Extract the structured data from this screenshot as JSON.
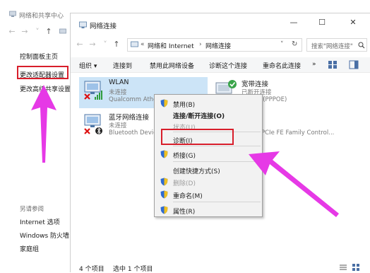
{
  "bg_window": {
    "title": "网络和共享中心",
    "sidebar": {
      "links": [
        "控制面板主页",
        "更改适配器设置",
        "更改高级共享设置"
      ],
      "see_also_label": "另请参阅",
      "see_also": [
        "Internet 选项",
        "Windows 防火墙",
        "家庭组"
      ]
    }
  },
  "main_window": {
    "title": "网络连接",
    "controls": {
      "minimize": "—",
      "maximize": "☐",
      "close": "✕"
    },
    "breadcrumb": {
      "prefix": "«",
      "parent": "网络和 Internet",
      "separator": "›",
      "current": "网络连接"
    },
    "search_placeholder": "搜索\"网络连接\"",
    "toolbar": [
      "组织 ▾",
      "连接到",
      "禁用此网络设备",
      "诊断这个连接",
      "重命名此连接",
      "»"
    ],
    "connections": [
      {
        "name": "WLAN",
        "status": "未连接",
        "device": "Qualcomm Athe"
      },
      {
        "name": "宽带连接",
        "status": "已断开连接",
        "device": "iniport (PPPOE)"
      },
      {
        "name": "蓝牙网络连接",
        "status": "未连接",
        "device": "Bluetooth Devic"
      },
      {
        "name": "",
        "status": "",
        "device": "PCIe FE Family Control..."
      }
    ],
    "status_bar": {
      "count": "4 个项目",
      "selected": "选中 1 个项目"
    }
  },
  "context_menu": {
    "items": [
      {
        "label": "禁用(B)",
        "icon": "shield-icon",
        "enabled": true,
        "bold": false
      },
      {
        "label": "连接/断开连接(O)",
        "icon": "",
        "enabled": true,
        "bold": true
      },
      {
        "label": "状态(U)",
        "icon": "",
        "enabled": false,
        "bold": false
      },
      {
        "label": "诊断(I)",
        "icon": "",
        "enabled": true,
        "bold": false
      },
      {
        "label": "桥接(G)",
        "icon": "shield-icon",
        "enabled": true,
        "bold": false
      },
      {
        "label": "创建快捷方式(S)",
        "icon": "",
        "enabled": true,
        "bold": false
      },
      {
        "label": "删除(D)",
        "icon": "shield-icon",
        "enabled": false,
        "bold": false
      },
      {
        "label": "重命名(M)",
        "icon": "shield-icon",
        "enabled": true,
        "bold": false
      },
      {
        "label": "属性(R)",
        "icon": "shield-icon",
        "enabled": true,
        "bold": false
      }
    ]
  },
  "colors": {
    "highlight_box": "#d81e2b",
    "annotation_arrow": "#e639e6",
    "selection": "#cce4f7"
  }
}
